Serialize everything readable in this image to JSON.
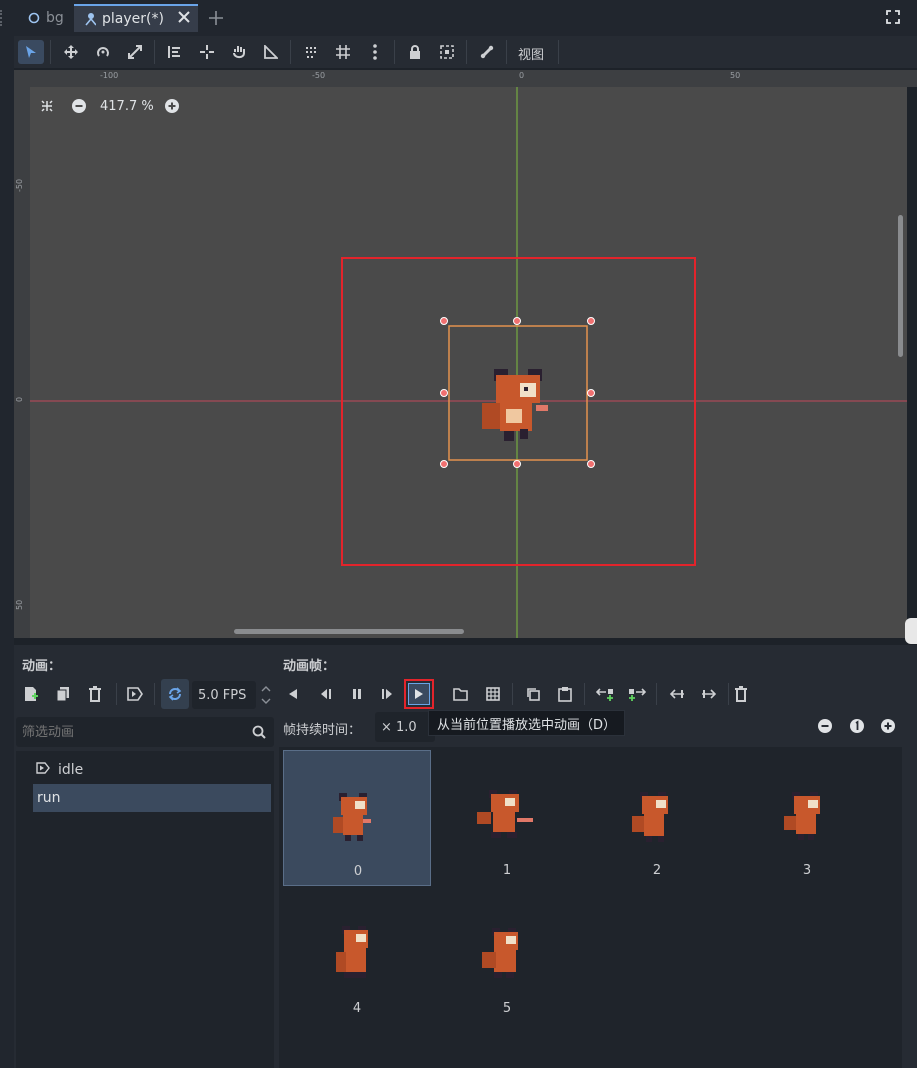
{
  "tabs": [
    {
      "label": "bg",
      "active": false
    },
    {
      "label": "player(*)",
      "active": true
    }
  ],
  "toolbar": {
    "view_label": "视图"
  },
  "ruler": {
    "top_ticks": [
      "-100",
      "-50",
      "0",
      "50"
    ],
    "left_ticks": [
      "-50",
      "0",
      "50"
    ]
  },
  "zoom": {
    "value": "417.7 %"
  },
  "animation_panel": {
    "title": "动画：",
    "filter_placeholder": "筛选动画",
    "animations": [
      {
        "name": "idle",
        "selected": false
      },
      {
        "name": "run",
        "selected": true
      }
    ]
  },
  "frames_panel": {
    "title": "动画帧：",
    "fps": "5.0 FPS",
    "duration_label": "帧持续时间：",
    "duration_value": "× 1.0",
    "tooltip": "从当前位置播放选中动画（D）",
    "frames": [
      "0",
      "1",
      "2",
      "3",
      "4",
      "5"
    ],
    "selected_frame": "0"
  },
  "colors": {
    "accent": "#6aa4e8",
    "selection_red": "#e3242b",
    "viewport_bg": "#4a4a4a"
  }
}
